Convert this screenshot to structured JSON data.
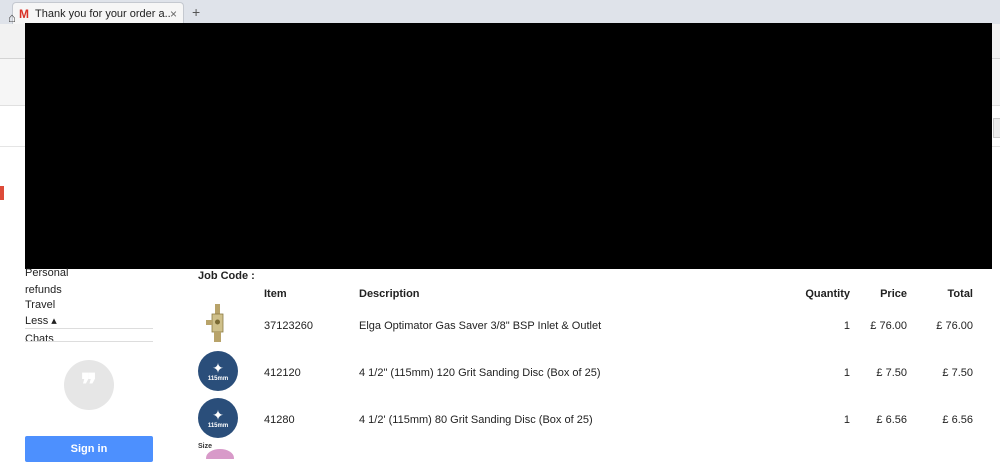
{
  "browser": {
    "tab_title": "Thank you for your order a...",
    "tab_close": "×",
    "new_tab": "+",
    "tab_icon": "gmail-icon",
    "home_icon": "home-icon"
  },
  "sidebar": {
    "items": [
      "Personal",
      "refunds",
      "Travel",
      "Less ▴",
      "Chats"
    ],
    "signin_label": "Sign in",
    "hangouts_icon": "hangouts-icon",
    "hangouts_glyph": "❞"
  },
  "order": {
    "job_code_label": "Job Code :",
    "columns": [
      "Item",
      "Description",
      "Quantity",
      "Price",
      "Total"
    ],
    "rows": [
      {
        "item": "37123260",
        "description": "Elga Optimator Gas Saver 3/8\" BSP Inlet & Outlet",
        "quantity": "1",
        "price": "£ 76.00",
        "total": "£ 76.00",
        "thumb_icon": "gas-saver-icon"
      },
      {
        "item": "412120",
        "description": "4 1/2\" (115mm) 120 Grit Sanding Disc (Box of 25)",
        "quantity": "1",
        "price": "£ 7.50",
        "total": "£ 7.50",
        "thumb_icon": "sanding-disc-icon",
        "thumb_label": "115mm"
      },
      {
        "item": "41280",
        "description": "4 1/2' (115mm) 80 Grit Sanding Disc (Box of 25)",
        "quantity": "1",
        "price": "£ 6.56",
        "total": "£ 6.56",
        "thumb_icon": "sanding-disc-icon",
        "thumb_label": "115mm"
      }
    ],
    "partial_thumb_label": "Size"
  },
  "colors": {
    "gmail_red": "#d93025",
    "signin_blue": "#4d90fe",
    "disc_blue": "#2a4e7a",
    "redaction": "#000000"
  }
}
